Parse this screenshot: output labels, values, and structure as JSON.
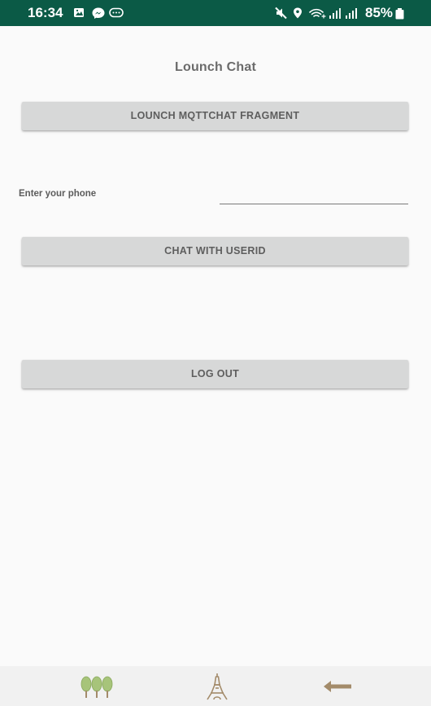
{
  "status_bar": {
    "time": "16:34",
    "battery_percent": "85%",
    "left_icons": [
      "gallery-icon",
      "messenger-icon",
      "chat-bubble-icon"
    ],
    "right_icons": [
      "mute-icon",
      "location-icon",
      "wifi-icon",
      "signal-icon",
      "signal-icon-2",
      "battery-icon"
    ]
  },
  "screen": {
    "title": "Lounch Chat"
  },
  "buttons": {
    "launch_fragment": "LOUNCH MQTTCHAT FRAGMENT",
    "chat_with_userid": "CHAT WITH USERID",
    "log_out": "LOG OUT"
  },
  "phone": {
    "label": "Enter your phone",
    "value": ""
  },
  "nav_bar": {
    "items": [
      "trees-icon",
      "eiffel-tower-icon",
      "back-arrow-icon"
    ]
  },
  "colors": {
    "status_bar": "#0b5a46",
    "background": "#fafafa",
    "button": "#d7d8d8",
    "button_text": "#5e5e5e",
    "nav_bar": "#f1f1f1"
  }
}
